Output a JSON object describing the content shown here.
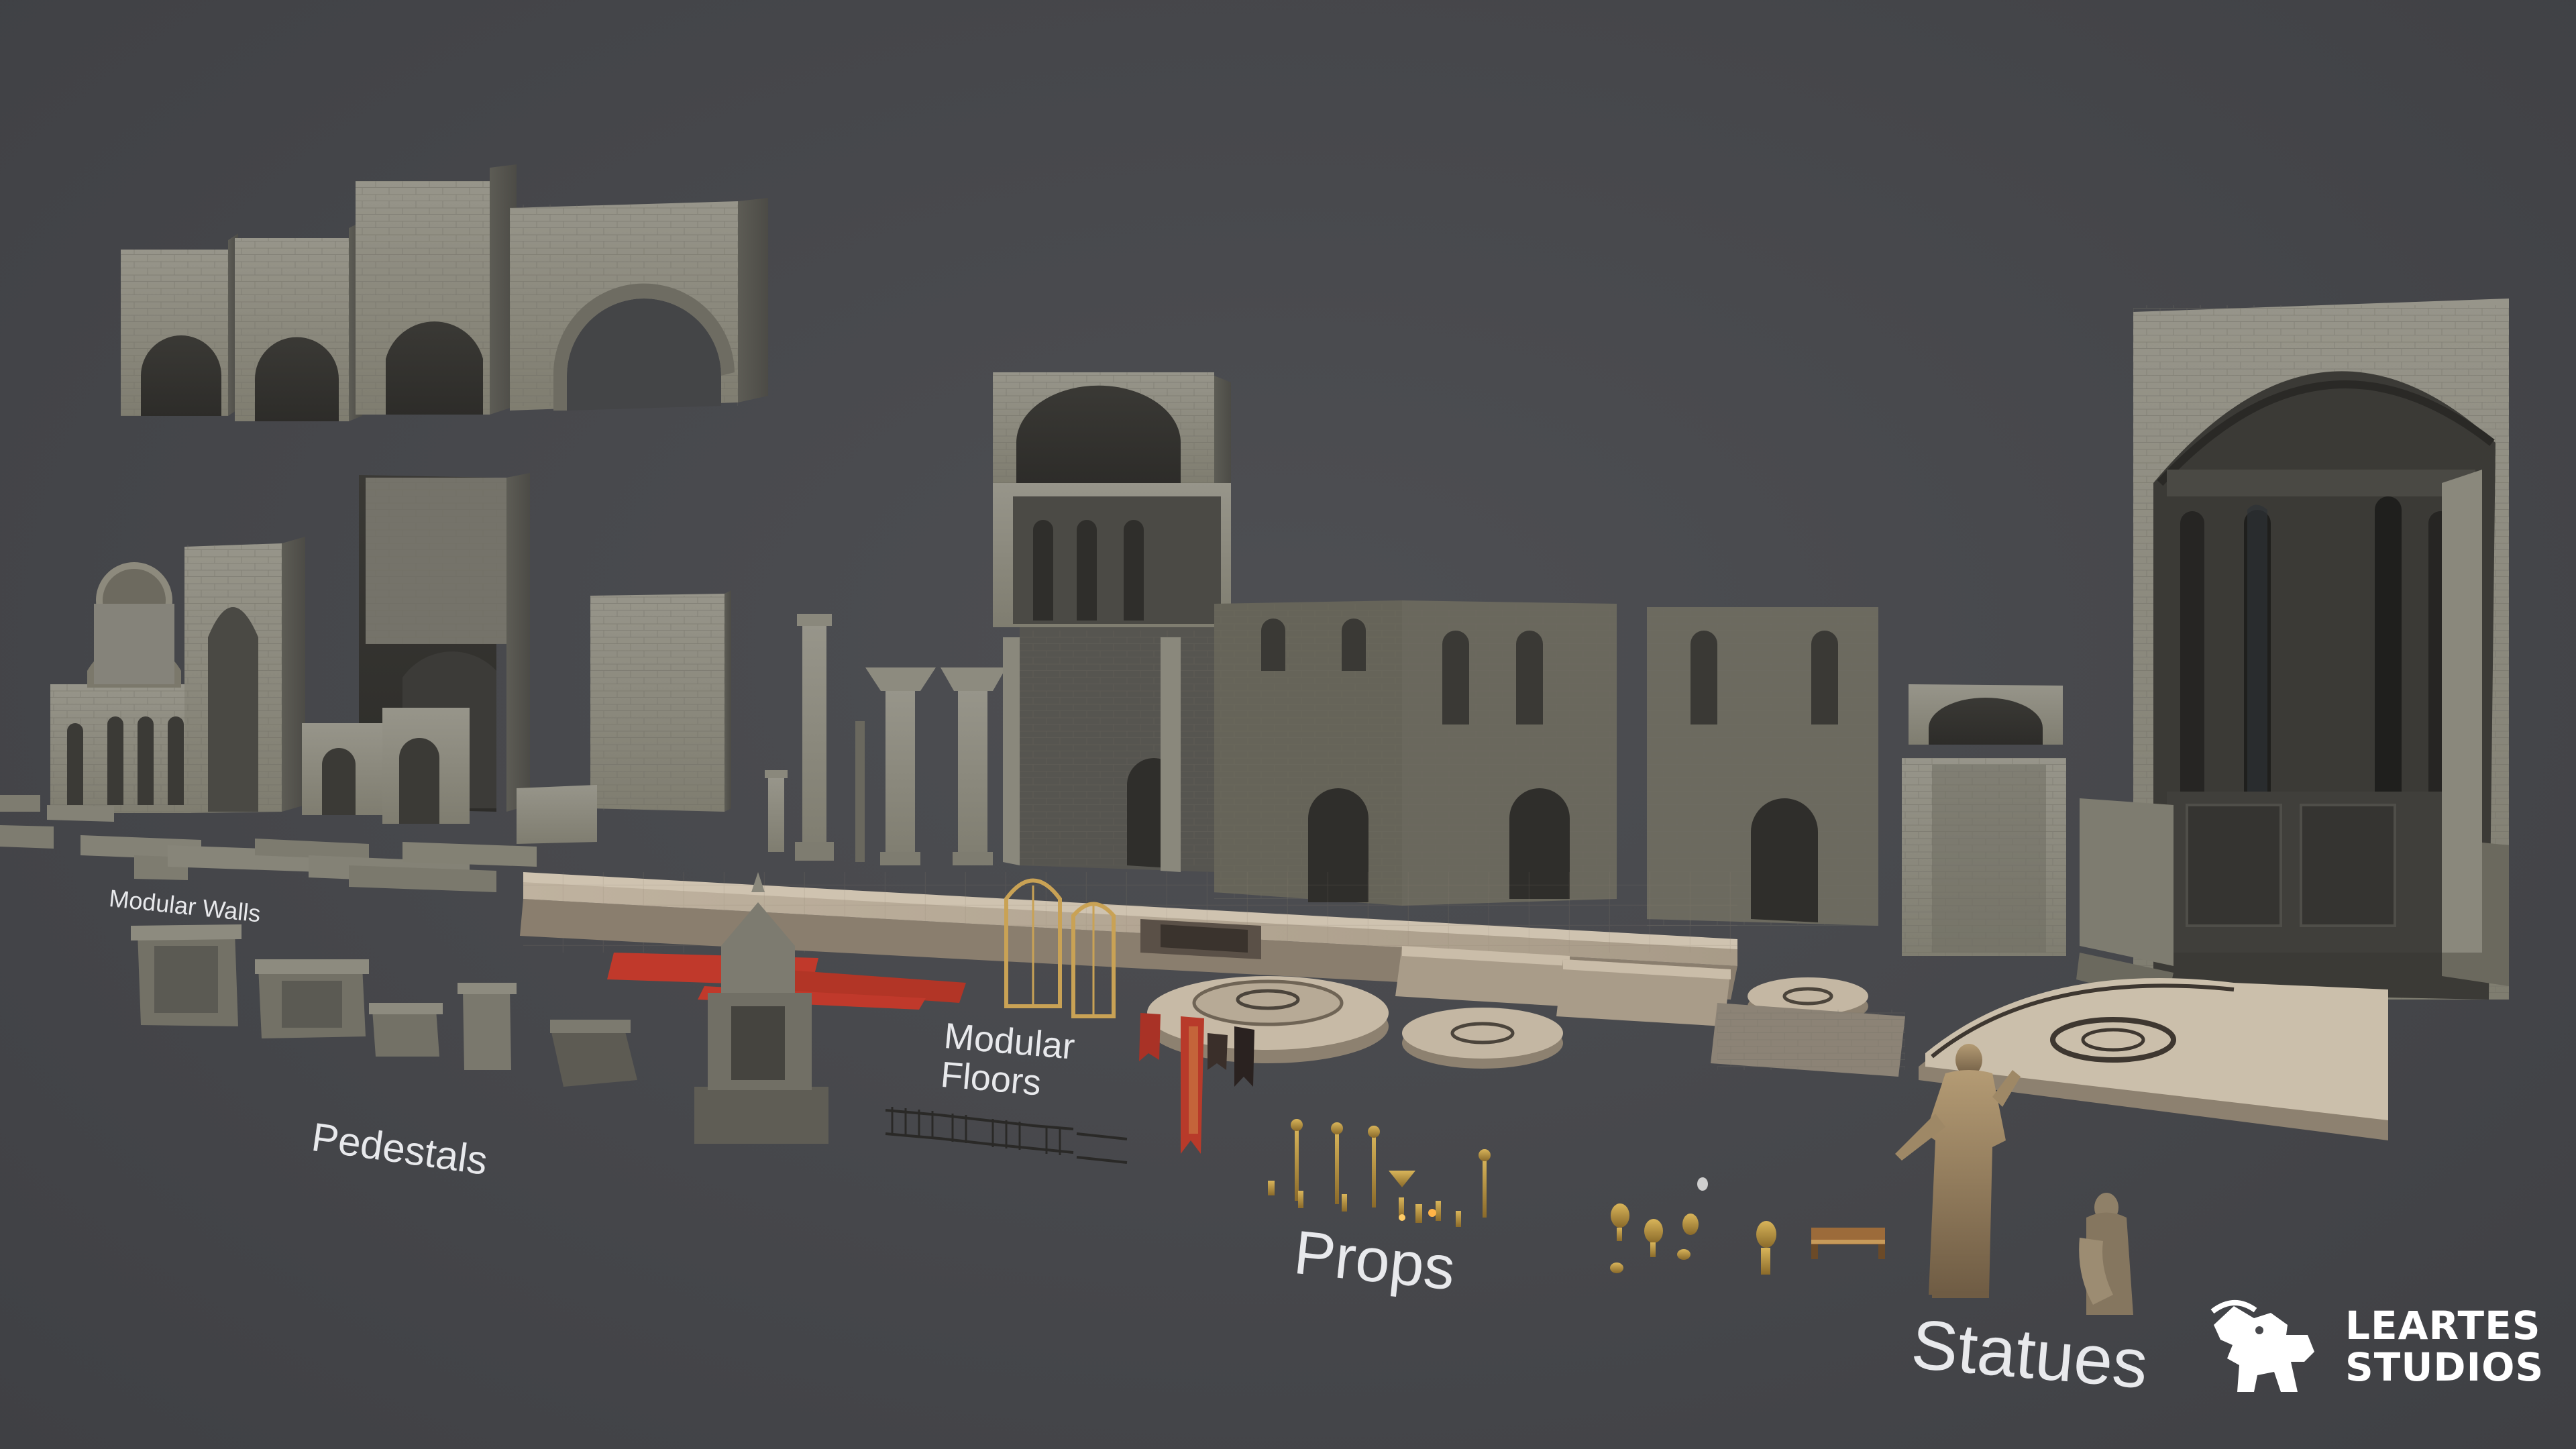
{
  "scene": {
    "background": "#47484c",
    "stone_color": "#8c8a7c",
    "carpet_color": "#c0392b"
  },
  "labels": {
    "modular_walls": "Modular Walls",
    "pedestals": "Pedestals",
    "modular_floors_line1": "Modular",
    "modular_floors_line2": "Floors",
    "props": "Props",
    "statues": "Statues"
  },
  "logo": {
    "line1": "LEARTES",
    "line2": "STUDIOS",
    "icon": "lion-icon"
  }
}
